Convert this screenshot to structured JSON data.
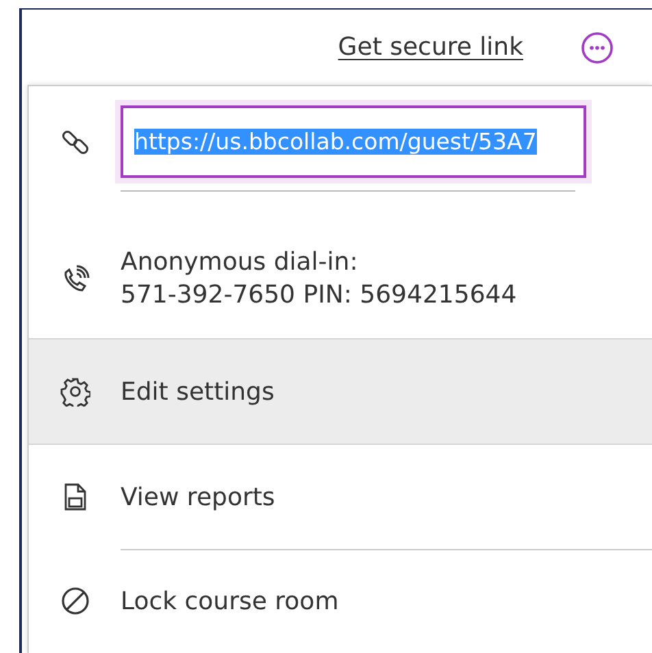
{
  "header": {
    "link": "Get secure link"
  },
  "menu": [
    {
      "kind": "link",
      "url": "https://us.bbcollab.com/guest/53A7",
      "text_selected": true,
      "highlighted": false
    },
    {
      "kind": "info",
      "lines": [
        "Anonymous dial-in:",
        "571-392-7650 PIN: 5694215644"
      ],
      "highlighted": false
    },
    {
      "kind": "action",
      "label": "Edit settings",
      "highlighted": true
    },
    {
      "kind": "action",
      "label": "View reports",
      "highlighted": false
    },
    {
      "kind": "action",
      "label": "Lock course room",
      "highlighted": false
    }
  ]
}
